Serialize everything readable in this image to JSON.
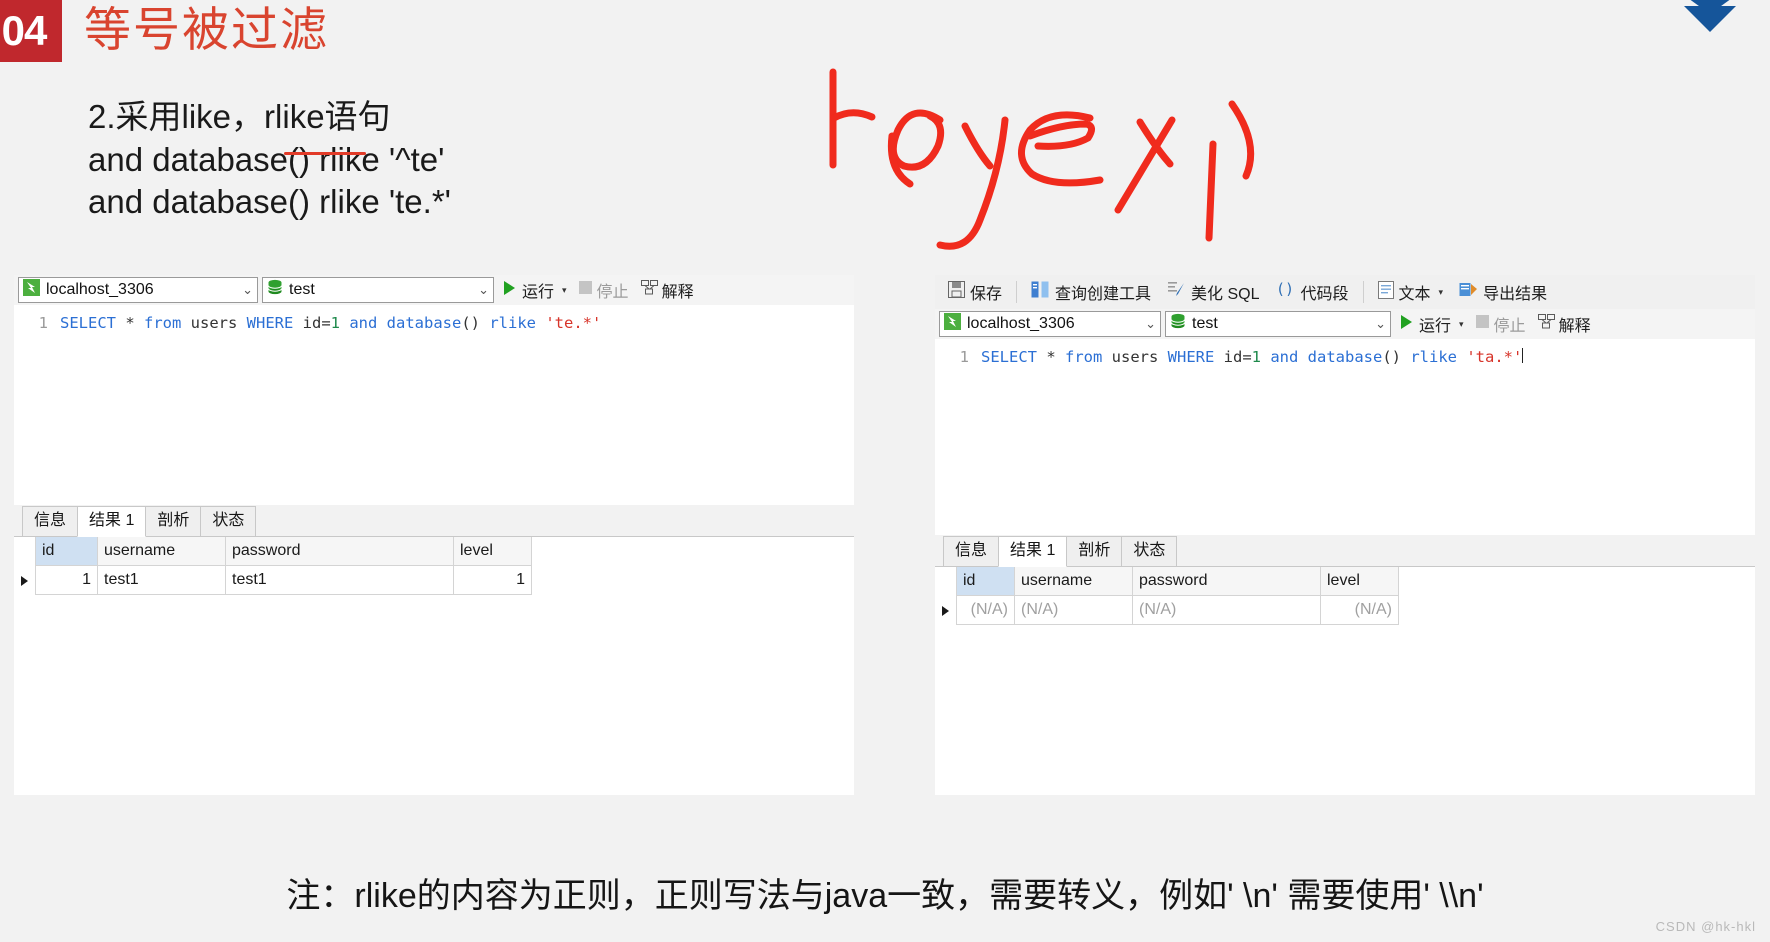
{
  "slide": {
    "section_number": "04",
    "title": "等号被过滤",
    "logo_icon": "chevron-logo-icon",
    "bullets": [
      "2.采用like，rlike语句",
      "and database() rlike '^te'",
      "and database() rlike 'te.*'"
    ],
    "handwriting_annotation": "regexp",
    "caption": "注：rlike的内容为正则，正则写法与java一致，需要转义，例如' \\n' 需要使用' \\\\n'",
    "watermark": "CSDN @hk-hkl",
    "colors": {
      "accent_red": "#c0282d",
      "title_red": "#d9442f",
      "ink_red": "#f02b1d",
      "logo_blue": "#15559a",
      "sql_keyword": "#2b6fd4",
      "sql_string": "#d7342a",
      "sql_number": "#1f8a4c",
      "header_select": "#cfe0f2"
    }
  },
  "left_window": {
    "connection": {
      "icon": "connection-icon",
      "value": "localhost_3306",
      "chevron": "chevron-down-icon"
    },
    "database": {
      "icon": "database-icon",
      "value": "test",
      "chevron": "chevron-down-icon"
    },
    "run_label": "运行",
    "run_icon": "play-icon",
    "run_caret": "caret-down-icon",
    "stop_label": "停止",
    "stop_icon": "stop-icon",
    "explain_label": "解释",
    "explain_icon": "explain-icon",
    "sql": {
      "line_number": "1",
      "tokens": [
        {
          "t": "SELECT",
          "c": "kw"
        },
        {
          "t": " * ",
          "c": "pn"
        },
        {
          "t": "from",
          "c": "kw"
        },
        {
          "t": " users ",
          "c": "pn"
        },
        {
          "t": "WHERE",
          "c": "kw"
        },
        {
          "t": " id=",
          "c": "pn"
        },
        {
          "t": "1",
          "c": "num"
        },
        {
          "t": " and ",
          "c": "kw"
        },
        {
          "t": "database",
          "c": "kw"
        },
        {
          "t": "() ",
          "c": "pn"
        },
        {
          "t": "rlike",
          "c": "kw"
        },
        {
          "t": " ",
          "c": "pn"
        },
        {
          "t": "'te.*'",
          "c": "str"
        }
      ],
      "plain": "SELECT * from users WHERE id=1 and database() rlike 'te.*'"
    },
    "result_tabs": [
      {
        "label": "信息",
        "active": false
      },
      {
        "label": "结果 1",
        "active": true
      },
      {
        "label": "剖析",
        "active": false
      },
      {
        "label": "状态",
        "active": false
      }
    ],
    "grid": {
      "columns": [
        "id",
        "username",
        "password",
        "level"
      ],
      "rows": [
        [
          "1",
          "test1",
          "test1",
          "1"
        ]
      ]
    }
  },
  "right_window": {
    "toolbar": [
      {
        "label": "保存",
        "icon": "save-icon"
      },
      {
        "label": "查询创建工具",
        "icon": "query-builder-icon"
      },
      {
        "label": "美化 SQL",
        "icon": "beautify-sql-icon"
      },
      {
        "label": "代码段",
        "icon": "code-snippet-icon"
      },
      {
        "label": "文本",
        "icon": "text-icon",
        "caret": "caret-down-icon"
      },
      {
        "label": "导出结果",
        "icon": "export-result-icon"
      }
    ],
    "connection": {
      "icon": "connection-icon",
      "value": "localhost_3306",
      "chevron": "chevron-down-icon"
    },
    "database": {
      "icon": "database-icon",
      "value": "test",
      "chevron": "chevron-down-icon"
    },
    "run_label": "运行",
    "run_icon": "play-icon",
    "run_caret": "caret-down-icon",
    "stop_label": "停止",
    "stop_icon": "stop-icon",
    "explain_label": "解释",
    "explain_icon": "explain-icon",
    "sql": {
      "line_number": "1",
      "tokens": [
        {
          "t": "SELECT",
          "c": "kw"
        },
        {
          "t": " * ",
          "c": "pn"
        },
        {
          "t": "from",
          "c": "kw"
        },
        {
          "t": " users ",
          "c": "pn"
        },
        {
          "t": "WHERE",
          "c": "kw"
        },
        {
          "t": " id=",
          "c": "pn"
        },
        {
          "t": "1",
          "c": "num"
        },
        {
          "t": " and ",
          "c": "kw"
        },
        {
          "t": "database",
          "c": "kw"
        },
        {
          "t": "() ",
          "c": "pn"
        },
        {
          "t": "rlike",
          "c": "kw"
        },
        {
          "t": " ",
          "c": "pn"
        },
        {
          "t": "'ta.*'",
          "c": "str"
        }
      ],
      "plain": "SELECT * from users WHERE id=1 and database() rlike 'ta.*'"
    },
    "result_tabs": [
      {
        "label": "信息",
        "active": false
      },
      {
        "label": "结果 1",
        "active": true
      },
      {
        "label": "剖析",
        "active": false
      },
      {
        "label": "状态",
        "active": false
      }
    ],
    "grid": {
      "columns": [
        "id",
        "username",
        "password",
        "level"
      ],
      "rows": [
        [
          "(N/A)",
          "(N/A)",
          "(N/A)",
          "(N/A)"
        ]
      ]
    }
  }
}
